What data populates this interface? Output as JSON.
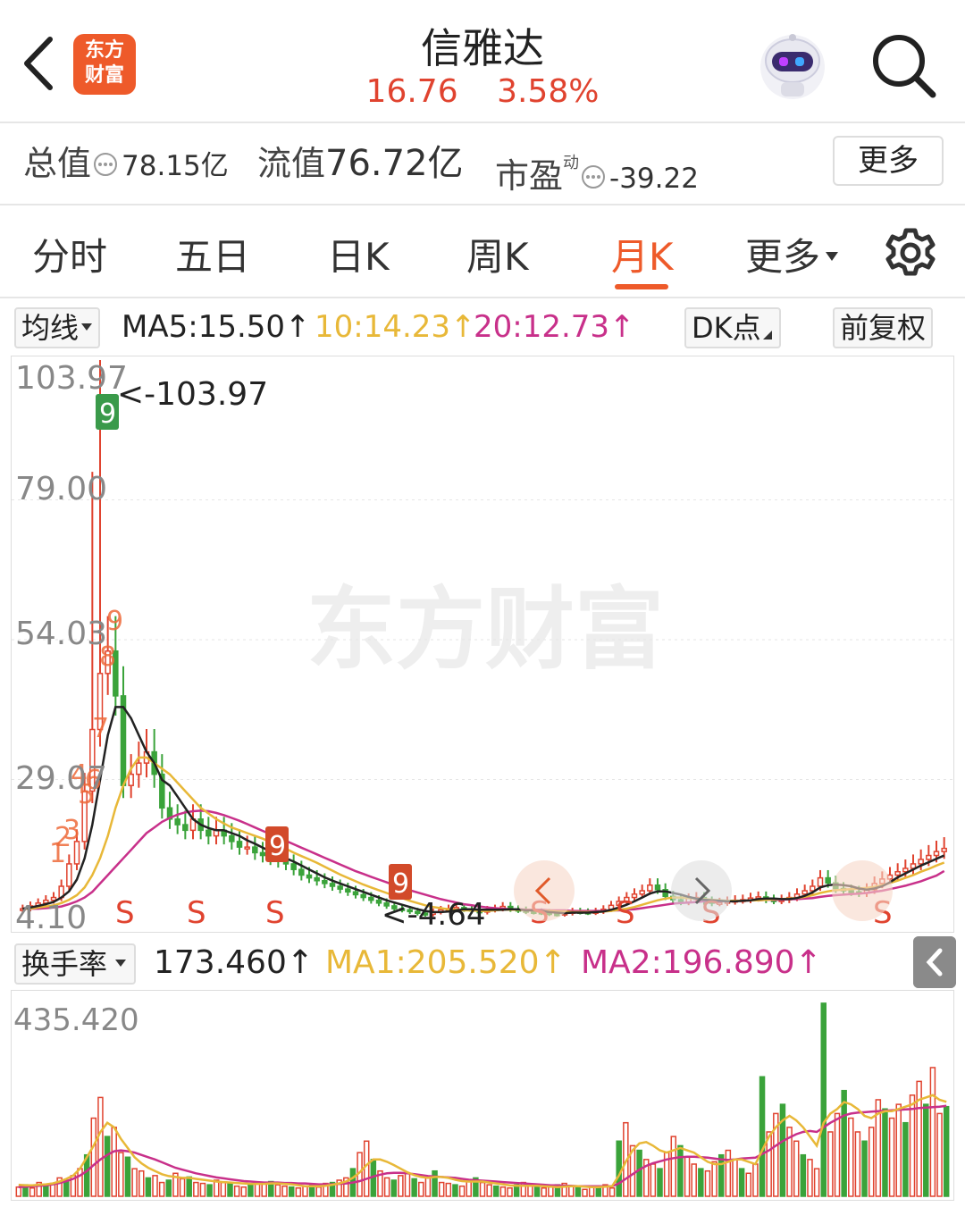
{
  "header": {
    "logo_line1": "东方",
    "logo_line2": "财富",
    "stock_name": "信雅达",
    "price": "16.76",
    "change_pct": "3.58%"
  },
  "metrics": {
    "total_value_label": "总值",
    "total_value": "78.15亿",
    "float_value_label": "流值",
    "float_value": "76.72亿",
    "pe_label": "市盈",
    "pe_sup": "动",
    "pe_value": "-39.22",
    "more_label": "更多"
  },
  "tabs": [
    "分时",
    "五日",
    "日K",
    "周K",
    "月K",
    "更多"
  ],
  "active_tab": "月K",
  "ma_bar": {
    "selector": "均线",
    "ma5": "MA5:15.50↑",
    "ma10": "10:14.23↑",
    "ma20": "20:12.73↑",
    "dk_label": "DK点",
    "adjust_label": "前复权"
  },
  "turnover_bar": {
    "selector": "换手率",
    "value": "173.460↑",
    "ma1": "MA1:205.520↑",
    "ma2": "MA2:196.890↑"
  },
  "colors": {
    "up": "#e0432f",
    "down": "#3aa33a",
    "accent": "#ee5a2a",
    "ma5": "#222222",
    "ma10": "#e8b838",
    "ma20": "#c8308a"
  },
  "chart_data": {
    "type": "candlestick",
    "period": "monthly",
    "y_ticks": [
      "103.97",
      "79.00",
      "54.03",
      "29.07",
      "4.10"
    ],
    "ylim": [
      4.1,
      103.97
    ],
    "max_marker": "<-103.97",
    "min_marker": "<-4.64",
    "watermark": "东方财富",
    "signal_letters": [
      "S",
      "S",
      "S",
      "S",
      "S",
      "S",
      "S"
    ],
    "td_counts_up": [
      "1",
      "2",
      "3",
      "4",
      "5",
      "6",
      "7",
      "8",
      "9"
    ],
    "td_counts_down": [
      "9",
      "9",
      "9"
    ],
    "closes": [
      6,
      6.5,
      7,
      7.5,
      8,
      10,
      14,
      18,
      27,
      38,
      48,
      52,
      44,
      28,
      30,
      32,
      34,
      30,
      24,
      22,
      21,
      20,
      22,
      20,
      19,
      20,
      19,
      18,
      17,
      17,
      16,
      15.5,
      15,
      14.5,
      14,
      13,
      12,
      11.5,
      11,
      10.5,
      10,
      9.5,
      9,
      8.5,
      8,
      7.5,
      7,
      6.5,
      6,
      5.8,
      5.5,
      5.2,
      5.0,
      5.4,
      5.8,
      6,
      6.2,
      5.9,
      5.6,
      5.4,
      5.8,
      6.0,
      6.4,
      5.9,
      5.7,
      5.5,
      5.4,
      5.3,
      5.1,
      5.0,
      5.2,
      5.5,
      5.4,
      5.3,
      5.5,
      5.9,
      6.6,
      7.3,
      8,
      8.6,
      9.2,
      10.2,
      9.4,
      8.2,
      7.6,
      7.2,
      7.8,
      8.0,
      7.3,
      7.0,
      7.1,
      7.3,
      7.5,
      7.6,
      7.9,
      8.1,
      7.6,
      7.4,
      7.6,
      8.0,
      8.6,
      9.2,
      10.0,
      11.5,
      10.6,
      9.6,
      9.2,
      9.0,
      8.8,
      9.4,
      10.5,
      11.3,
      12.0,
      12.6,
      13.2,
      14.0,
      14.8,
      15.5,
      16.2,
      16.76
    ],
    "ma5": [
      6,
      6.2,
      6.5,
      6.8,
      7.2,
      8,
      9.1,
      11.2,
      15,
      21,
      29,
      37,
      42,
      42,
      40,
      37,
      34,
      32,
      29,
      28,
      26,
      24,
      22,
      21,
      20.4,
      20,
      20,
      19.5,
      19,
      18.2,
      17.6,
      16.9,
      16.2,
      15.6,
      15,
      14.4,
      13.7,
      13,
      12.3,
      11.6,
      11,
      10.5,
      10,
      9.5,
      9,
      8.5,
      8,
      7.5,
      7.1,
      6.7,
      6.3,
      5.9,
      5.6,
      5.4,
      5.4,
      5.5,
      5.7,
      5.9,
      5.9,
      5.8,
      5.8,
      5.8,
      5.8,
      5.9,
      5.9,
      5.7,
      5.7,
      5.6,
      5.4,
      5.3,
      5.2,
      5.3,
      5.3,
      5.3,
      5.4,
      5.5,
      5.8,
      6.2,
      6.7,
      7.3,
      8,
      8.7,
      9.1,
      9.1,
      8.8,
      8.5,
      8.1,
      7.8,
      7.6,
      7.5,
      7.4,
      7.3,
      7.3,
      7.4,
      7.5,
      7.7,
      7.8,
      7.8,
      7.7,
      7.7,
      7.9,
      8.3,
      8.9,
      9.8,
      10.2,
      10.3,
      10.2,
      10.0,
      9.6,
      9.4,
      9.6,
      10.0,
      10.7,
      11.6,
      12.3,
      13.0,
      13.7,
      14.3,
      14.9,
      15.5
    ],
    "ma10": [
      6,
      6,
      6.2,
      6.4,
      6.6,
      7,
      7.6,
      8.4,
      9.8,
      12,
      15,
      19,
      24,
      28,
      31,
      33,
      33,
      32,
      31,
      30,
      28.5,
      27,
      25.5,
      24,
      23,
      22,
      21.2,
      20.5,
      20,
      19.5,
      19,
      18.5,
      17.9,
      17.3,
      16.7,
      16,
      15.4,
      14.8,
      14.2,
      13.5,
      12.8,
      12.1,
      11.5,
      10.9,
      10.3,
      9.8,
      9.3,
      8.8,
      8.3,
      7.9,
      7.4,
      7.0,
      6.6,
      6.3,
      6.1,
      5.9,
      5.8,
      5.7,
      5.7,
      5.6,
      5.6,
      5.7,
      5.8,
      5.8,
      5.8,
      5.7,
      5.7,
      5.6,
      5.6,
      5.5,
      5.5,
      5.4,
      5.4,
      5.4,
      5.4,
      5.5,
      5.6,
      5.8,
      6.0,
      6.3,
      6.7,
      7.1,
      7.5,
      7.8,
      8.0,
      8.0,
      7.9,
      7.8,
      7.7,
      7.6,
      7.5,
      7.4,
      7.4,
      7.4,
      7.5,
      7.5,
      7.6,
      7.7,
      7.7,
      7.8,
      7.9,
      8.1,
      8.4,
      8.8,
      9.1,
      9.3,
      9.4,
      9.5,
      9.6,
      9.7,
      9.9,
      10.2,
      10.6,
      11.0,
      11.5,
      12.0,
      12.6,
      13.1,
      13.7,
      14.23
    ],
    "ma20": [
      6,
      6,
      6,
      6.1,
      6.2,
      6.4,
      6.8,
      7.3,
      8,
      9,
      10.5,
      12,
      13.5,
      15,
      16.5,
      18,
      19.5,
      20.5,
      21.5,
      22.2,
      22.8,
      23.2,
      23.4,
      23.5,
      23.4,
      23.1,
      22.7,
      22.2,
      21.7,
      21.1,
      20.5,
      19.9,
      19.3,
      18.7,
      18.1,
      17.5,
      16.9,
      16.3,
      15.7,
      15.1,
      14.5,
      13.9,
      13.3,
      12.7,
      12.2,
      11.7,
      11.2,
      10.7,
      10.2,
      9.8,
      9.3,
      8.9,
      8.5,
      8.1,
      7.7,
      7.4,
      7.1,
      6.8,
      6.6,
      6.4,
      6.2,
      6.1,
      6.0,
      5.9,
      5.9,
      5.8,
      5.8,
      5.8,
      5.7,
      5.7,
      5.7,
      5.6,
      5.6,
      5.6,
      5.6,
      5.6,
      5.7,
      5.7,
      5.8,
      5.9,
      6.1,
      6.3,
      6.5,
      6.7,
      6.9,
      7.0,
      7.1,
      7.2,
      7.3,
      7.3,
      7.3,
      7.4,
      7.4,
      7.4,
      7.5,
      7.5,
      7.6,
      7.6,
      7.6,
      7.7,
      7.7,
      7.8,
      7.9,
      8.1,
      8.3,
      8.4,
      8.5,
      8.6,
      8.7,
      8.8,
      9.0,
      9.2,
      9.5,
      9.8,
      10.1,
      10.5,
      10.9,
      11.4,
      11.9,
      12.73
    ],
    "turnover_max_label": "435.420",
    "turnover_ylim": [
      0,
      435.42
    ],
    "turnover": [
      20,
      25,
      18,
      30,
      22,
      28,
      40,
      35,
      45,
      60,
      90,
      170,
      215,
      130,
      150,
      95,
      85,
      60,
      55,
      40,
      45,
      30,
      35,
      50,
      38,
      42,
      30,
      28,
      25,
      35,
      30,
      28,
      22,
      20,
      25,
      30,
      28,
      32,
      25,
      22,
      20,
      18,
      22,
      25,
      20,
      28,
      30,
      35,
      40,
      60,
      95,
      120,
      80,
      55,
      40,
      35,
      45,
      50,
      38,
      30,
      42,
      55,
      30,
      28,
      25,
      22,
      35,
      40,
      30,
      25,
      22,
      20,
      18,
      25,
      30,
      22,
      20,
      18,
      20,
      25,
      28,
      22,
      18,
      15,
      20,
      22,
      25,
      18,
      120,
      160,
      110,
      100,
      80,
      70,
      60,
      95,
      130,
      110,
      85,
      70,
      60,
      55,
      75,
      90,
      100,
      80,
      60,
      50,
      70,
      260,
      140,
      180,
      200,
      150,
      120,
      90,
      80,
      60,
      420,
      140,
      180,
      230,
      170,
      140,
      120,
      150,
      210,
      190,
      170,
      200,
      160,
      220,
      250,
      200,
      280,
      180,
      195
    ],
    "turnover_ma1": [
      25,
      24,
      24,
      25,
      26,
      28,
      32,
      38,
      45,
      60,
      85,
      110,
      140,
      160,
      150,
      125,
      105,
      85,
      72,
      62,
      55,
      48,
      44,
      42,
      40,
      40,
      38,
      36,
      34,
      32,
      31,
      30,
      29,
      28,
      27,
      27,
      27,
      28,
      28,
      27,
      26,
      24,
      22,
      22,
      22,
      23,
      25,
      28,
      32,
      40,
      52,
      68,
      80,
      80,
      75,
      68,
      60,
      52,
      46,
      42,
      40,
      42,
      42,
      40,
      36,
      33,
      32,
      32,
      32,
      30,
      28,
      26,
      24,
      23,
      23,
      23,
      23,
      22,
      21,
      20,
      21,
      22,
      22,
      21,
      20,
      20,
      21,
      22,
      45,
      75,
      100,
      115,
      118,
      110,
      100,
      95,
      100,
      105,
      100,
      95,
      85,
      75,
      70,
      70,
      75,
      80,
      80,
      75,
      70,
      100,
      130,
      150,
      165,
      175,
      165,
      150,
      130,
      110,
      160,
      180,
      190,
      205,
      200,
      190,
      175,
      170,
      180,
      185,
      185,
      190,
      195,
      200,
      210,
      215,
      220,
      210,
      205.52
    ],
    "turnover_ma2": [
      20,
      21,
      22,
      23,
      24,
      26,
      29,
      33,
      38,
      45,
      55,
      68,
      80,
      90,
      98,
      100,
      98,
      95,
      90,
      85,
      80,
      74,
      68,
      62,
      58,
      54,
      50,
      47,
      44,
      41,
      39,
      37,
      35,
      33,
      32,
      31,
      30,
      30,
      30,
      29,
      29,
      28,
      28,
      27,
      26,
      26,
      26,
      27,
      28,
      30,
      33,
      38,
      43,
      47,
      50,
      51,
      51,
      50,
      48,
      46,
      44,
      43,
      42,
      41,
      40,
      38,
      36,
      35,
      34,
      33,
      32,
      31,
      30,
      29,
      28,
      27,
      26,
      25,
      24,
      24,
      23,
      23,
      22,
      22,
      22,
      22,
      22,
      22,
      28,
      38,
      48,
      58,
      66,
      72,
      76,
      80,
      83,
      85,
      86,
      86,
      85,
      84,
      82,
      80,
      79,
      80,
      82,
      83,
      84,
      92,
      100,
      110,
      120,
      128,
      135,
      140,
      142,
      140,
      150,
      160,
      168,
      176,
      180,
      182,
      183,
      184,
      185,
      186,
      187,
      188,
      189,
      190,
      192,
      193,
      194,
      195,
      196.89
    ]
  }
}
